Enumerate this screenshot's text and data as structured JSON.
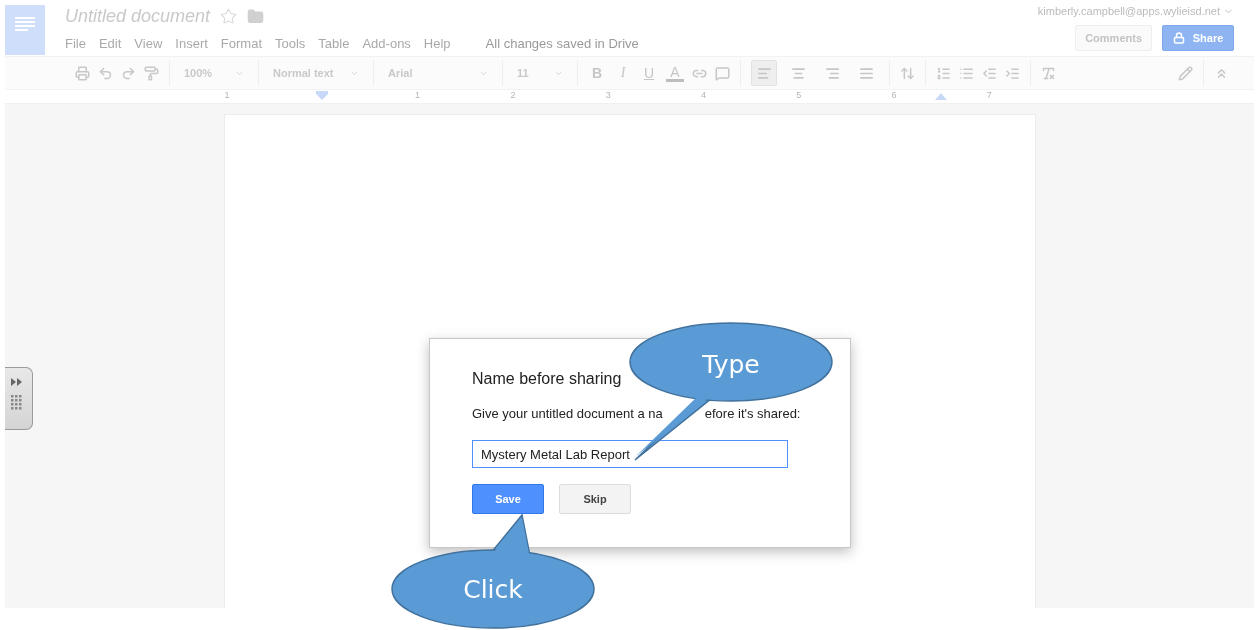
{
  "header": {
    "title": "Untitled document",
    "menus": [
      "File",
      "Edit",
      "View",
      "Insert",
      "Format",
      "Tools",
      "Table",
      "Add-ons",
      "Help"
    ],
    "save_status": "All changes saved in Drive",
    "account": "kimberly.campbell@apps.wylieisd.net",
    "comments_button": "Comments",
    "share_button": "Share"
  },
  "toolbar": {
    "zoom": "100%",
    "style": "Normal text",
    "font": "Arial",
    "size": "11",
    "format_buttons": [
      {
        "label": "B"
      },
      {
        "label": "I"
      },
      {
        "label": "U"
      },
      {
        "label": "A"
      }
    ],
    "alignment": [
      {
        "selected": true
      },
      {
        "selected": false
      },
      {
        "selected": false
      },
      {
        "selected": false
      }
    ]
  },
  "ruler": {
    "labels": [
      "1",
      "1",
      "2",
      "3",
      "4",
      "5",
      "6",
      "7"
    ]
  },
  "dialog": {
    "title": "Name before sharing",
    "message_parts": [
      "Give your untitled document a na",
      "efore it's shared:"
    ],
    "input_value": "Mystery Metal Lab Report",
    "buttons": [
      {
        "label": "Save",
        "kind": "primary"
      },
      {
        "label": "Skip",
        "kind": "secondary"
      }
    ]
  },
  "callouts": [
    {
      "text": "Type"
    },
    {
      "text": "Click"
    }
  ]
}
